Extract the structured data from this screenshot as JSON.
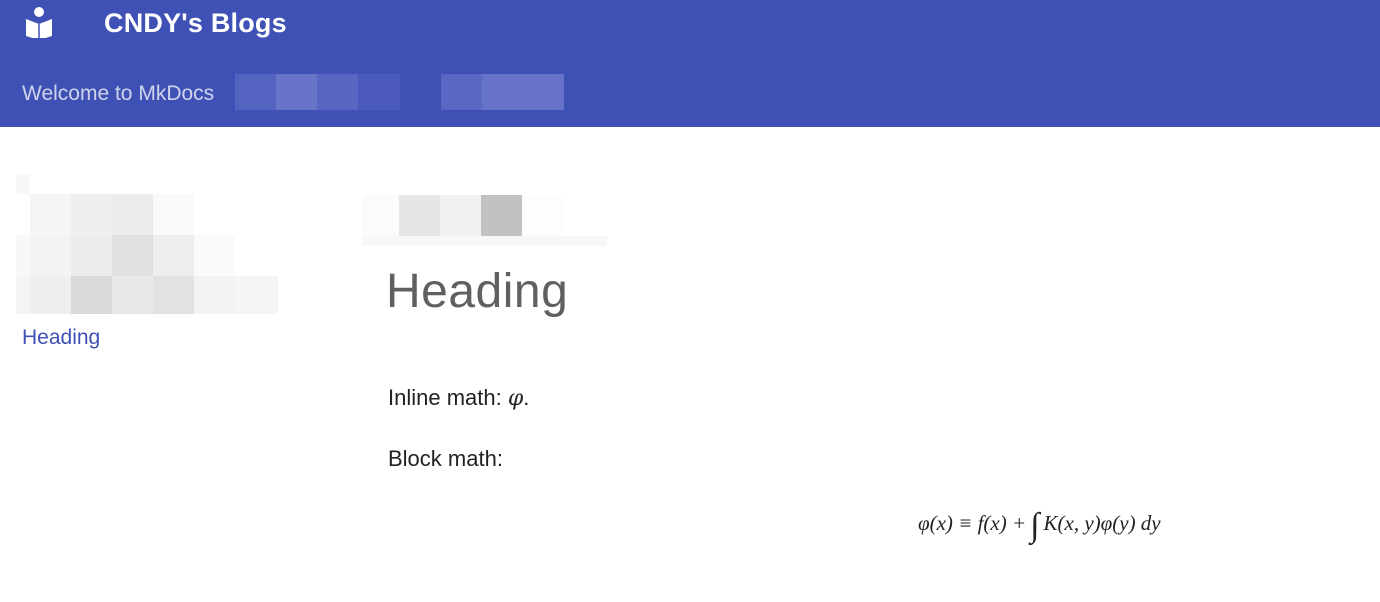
{
  "header": {
    "site_title": "CNDY's Blogs",
    "logo_icon": "book-reader-icon",
    "tabs": [
      {
        "label": "Welcome to MkDocs"
      }
    ],
    "background_color": "#3f51b5"
  },
  "sidebar": {
    "toc_items": [
      {
        "label": "Heading"
      }
    ]
  },
  "content": {
    "heading": "Heading",
    "inline_math_label": "Inline math: ",
    "inline_math_symbol": "φ",
    "inline_math_tail": ".",
    "block_math_label": "Block math:",
    "block_math_left": "φ(x) ≡ f(x) +",
    "block_math_integral": "∫",
    "block_math_right": "K(x, y)φ(y) dy"
  },
  "colors": {
    "accent": "#3f51b5",
    "link": "#3f51b5",
    "heading_text": "#606060"
  }
}
